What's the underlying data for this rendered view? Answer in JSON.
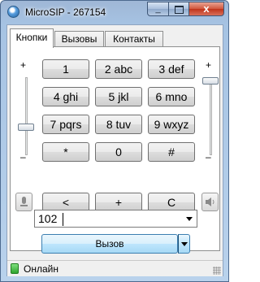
{
  "window": {
    "title": "MicroSIP - 267154",
    "close_glyph": "x",
    "min_glyph": "_"
  },
  "tabs": [
    {
      "label": "Кнопки",
      "active": true
    },
    {
      "label": "Вызовы",
      "active": false
    },
    {
      "label": "Контакты",
      "active": false
    }
  ],
  "keypad": {
    "keys": [
      "1",
      "2 abc",
      "3 def",
      "4 ghi",
      "5 jkl",
      "6 mno",
      "7 pqrs",
      "8 tuv",
      "9 wxyz",
      "*",
      "0",
      "#"
    ],
    "back": "<",
    "plus": "+",
    "clear": "C"
  },
  "mic_volume": {
    "plus": "+",
    "minus": "–",
    "level": 0.35,
    "icon": "microphone-icon"
  },
  "speaker_volume": {
    "plus": "+",
    "minus": "–",
    "level": 1.0,
    "icon": "speaker-icon"
  },
  "dial_input": {
    "value": "102"
  },
  "call_button": {
    "label": "Вызов"
  },
  "status": {
    "text": "Онлайн",
    "icon": "online-status-icon",
    "color": "#2fa52f"
  }
}
